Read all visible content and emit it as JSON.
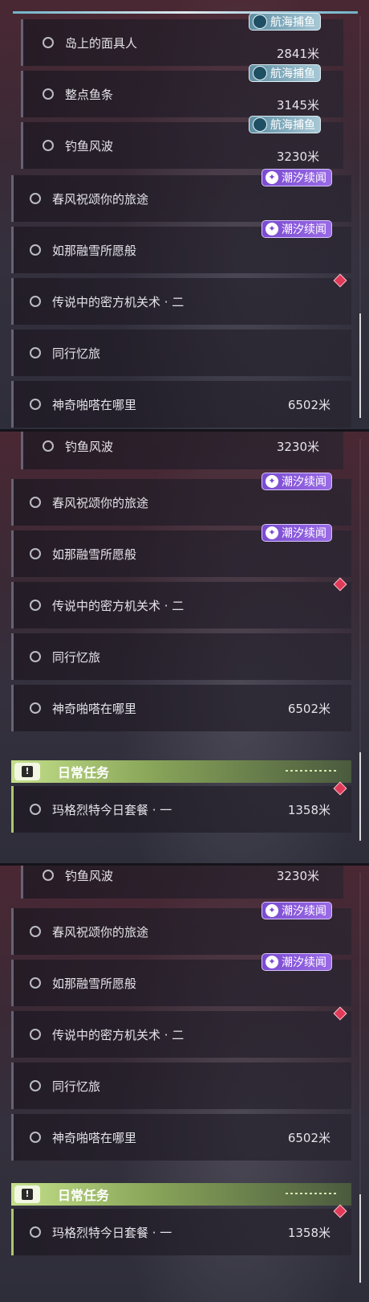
{
  "badges": {
    "tide": "潮汐续闻",
    "sea": "航海捕鱼"
  },
  "daily_header": {
    "title": "日常任务",
    "icon": "!"
  },
  "quests": {
    "masks": {
      "name": "岛上的面具人",
      "dist": "2841米"
    },
    "fish": {
      "name": "整点鱼条",
      "dist": "3145米"
    },
    "wave": {
      "name": "钓鱼风波",
      "dist": "3230米"
    },
    "spring": {
      "name": "春风祝颂你的旅途"
    },
    "snow": {
      "name": "如那融雪所愿般"
    },
    "legend": {
      "name": "传说中的密方机关术 · 二"
    },
    "memory": {
      "name": "同行忆旅"
    },
    "where": {
      "name": "神奇啪嗒在哪里",
      "dist": "6502米"
    },
    "meal": {
      "name": "玛格烈特今日套餐 · 一",
      "dist": "1358米"
    }
  },
  "colors": {
    "tide_badge": "#8a5ae0",
    "sea_badge": "#8cb8cc",
    "daily_accent": "#b8d47a",
    "marker": "#e03a58"
  }
}
